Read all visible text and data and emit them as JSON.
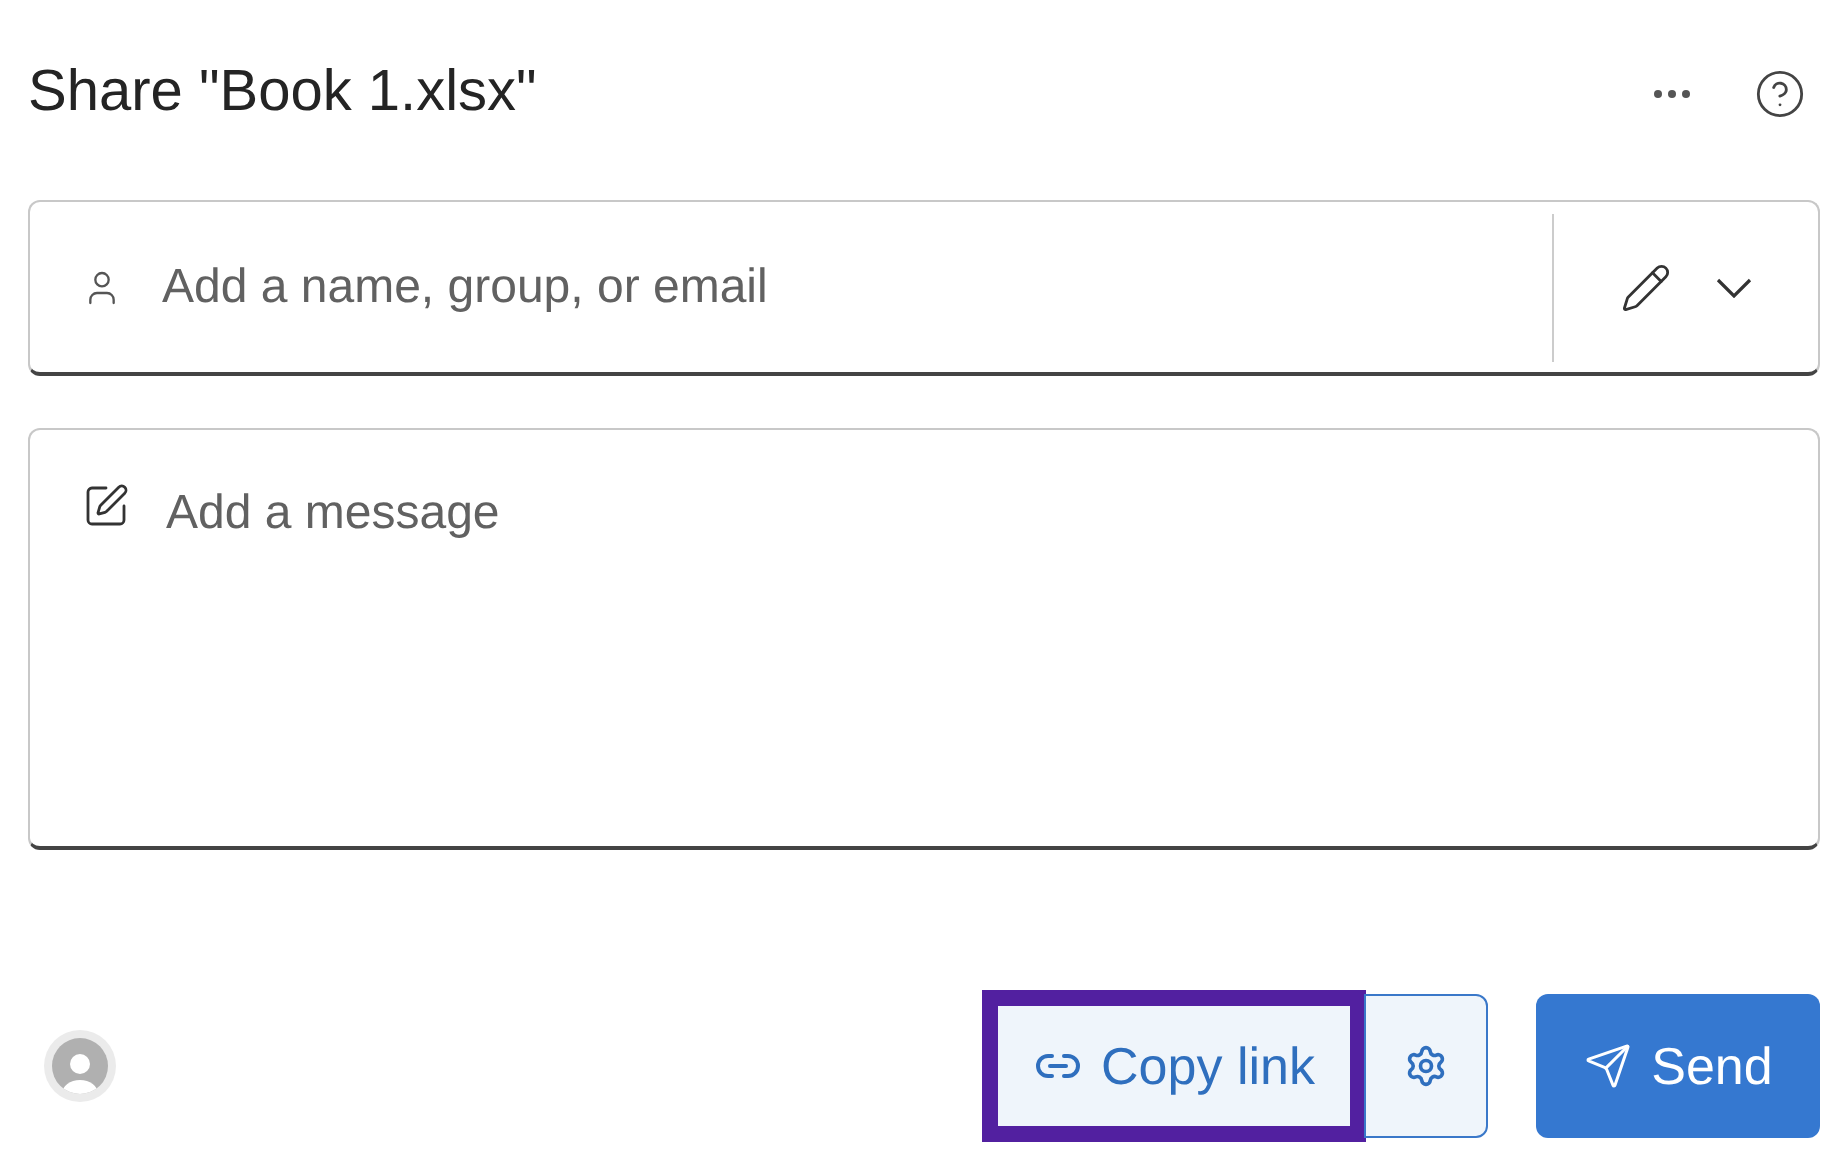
{
  "dialog": {
    "title": "Share \"Book 1.xlsx\""
  },
  "recipients": {
    "placeholder": "Add a name, group, or email"
  },
  "message": {
    "placeholder": "Add a message"
  },
  "copy_link": {
    "label": "Copy link",
    "highlighted": true
  },
  "send": {
    "label": "Send"
  }
}
